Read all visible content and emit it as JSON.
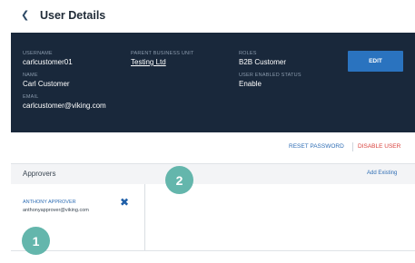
{
  "header": {
    "title": "User Details",
    "back_icon": "chevron-left-icon"
  },
  "profile": {
    "username_label": "USERNAME",
    "username": "carlcustomer01",
    "name_label": "NAME",
    "name": "Carl Customer",
    "email_label": "EMAIL",
    "email": "carlcustomer@viking.com",
    "business_unit_label": "PARENT BUSINESS UNIT",
    "business_unit": "Testing Ltd",
    "roles_label": "ROLES",
    "roles": "B2B Customer",
    "status_label": "USER ENABLED STATUS",
    "status": "Enable",
    "edit_label": "EDIT"
  },
  "actions": {
    "reset_password": "RESET PASSWORD",
    "disable_user": "DISABLE USER"
  },
  "approvers": {
    "title": "Approvers",
    "add_existing": "Add Existing",
    "items": [
      {
        "name": "ANTHONY APPROVER",
        "email": "anthonyapprover@viking.com"
      }
    ]
  },
  "badges": [
    "1",
    "2"
  ],
  "colors": {
    "banner": "#19283b",
    "accent": "#2a73bf",
    "danger": "#d8413c",
    "badge": "#64b6ac"
  }
}
